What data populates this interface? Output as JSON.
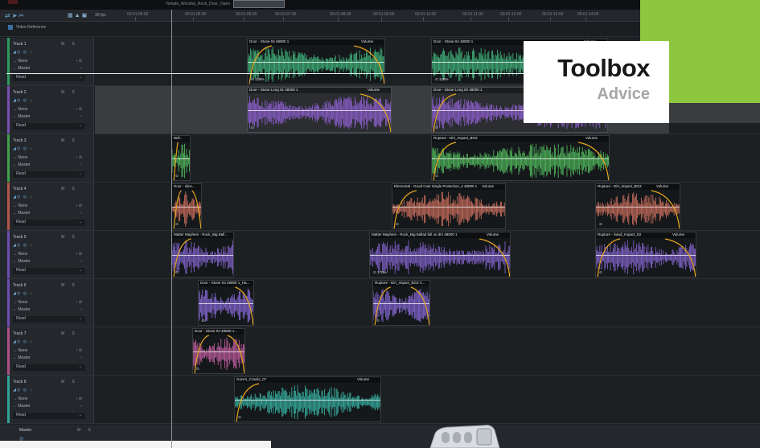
{
  "topbar": {
    "project_title": "Temple_Worship_Rock_Door_Open"
  },
  "toolbar": {
    "fps": "30 fps"
  },
  "ruler": {
    "ticks": [
      "00:01:04:00",
      "00:01:05:00",
      "00:01:06:00",
      "00:01:07:00",
      "00:01:08:00",
      "00:01:09:00",
      "00:01:10:00",
      "00:01:11:00",
      "00:01:12:00",
      "00:01:13:00",
      "00:01:14:00"
    ]
  },
  "video_reference": {
    "label": "Video Reference"
  },
  "track_controls": {
    "ms": "M S",
    "none": "None",
    "master": "Master",
    "read": "Read"
  },
  "tracks": [
    {
      "name": "Track 1",
      "color": "#2e9b5a",
      "wave_color": "#3fae78",
      "clips": [
        {
          "name": "Door - Stone 04 48000 1",
          "volume_label": "Volume",
          "pct": "128%"
        },
        {
          "name": "Door - Stone 04 48000 1",
          "volume_label": "Volume",
          "pct": "128%"
        }
      ]
    },
    {
      "name": "Track 2",
      "color": "#7b4fb3",
      "wave_color": "#8a5ec9",
      "clips": [
        {
          "name": "Door - Stone Long 01 48000 1",
          "volume_label": "Volume",
          "pct": ""
        },
        {
          "name": "Door - Stone Long 02 48000 1",
          "volume_label": "Volume",
          "pct": ""
        }
      ]
    },
    {
      "name": "Track 3",
      "color": "#3fa24a",
      "wave_color": "#4fb35b",
      "clips": [
        {
          "name": "Bell...",
          "volume_label": "",
          "pct": ""
        },
        {
          "name": "Rupture - Dirt_Impact_BG3",
          "volume_label": "Volume",
          "pct": ""
        }
      ]
    },
    {
      "name": "Track 4",
      "color": "#b3584a",
      "wave_color": "#c26a5a",
      "clips": [
        {
          "name": "Door - slice...",
          "volume_label": "",
          "pct": ""
        },
        {
          "name": "Elemental - Good Cast Single Protection_4 48000 1",
          "volume_label": "Volume",
          "pct": ""
        },
        {
          "name": "Rupture - Dirt_Impact_BG3",
          "volume_label": "Volume",
          "pct": ""
        }
      ]
    },
    {
      "name": "Track 5",
      "color": "#6d4fb3",
      "wave_color": "#7d60c4",
      "clips": [
        {
          "name": "Matter Mayhem - Rock_Big Ball...",
          "volume_label": "",
          "pct": ""
        },
        {
          "name": "Matter Mayhem - Rock_Big Ballad fall on dirt 48000 1",
          "volume_label": "Volume",
          "pct": "170%"
        },
        {
          "name": "Rupture - Sand_Impact_03",
          "volume_label": "Volume",
          "pct": ""
        }
      ]
    },
    {
      "name": "Track 6",
      "color": "#6d4fb3",
      "wave_color": "#8165cf",
      "clips": [
        {
          "name": "Door - Stone 03 48000 1_Ha...",
          "volume_label": "",
          "pct": ""
        },
        {
          "name": "Rupture - Dirt_Impact_BG3 V...",
          "volume_label": "",
          "pct": ""
        }
      ]
    },
    {
      "name": "Track 7",
      "color": "#b04f86",
      "wave_color": "#b95a9a",
      "clips": [
        {
          "name": "Door - Stone 03 48000 1...",
          "volume_label": "",
          "pct": ""
        }
      ]
    },
    {
      "name": "Track 8",
      "color": "#2fa596",
      "wave_color": "#35a89a",
      "clips": [
        {
          "name": "Gore's_Cracks_07",
          "volume_label": "Volume",
          "pct": ""
        }
      ]
    }
  ],
  "master_track": {
    "name": "Master",
    "ms": "M S"
  },
  "overlay": {
    "title": "Toolbox",
    "subtitle": "Advice"
  }
}
